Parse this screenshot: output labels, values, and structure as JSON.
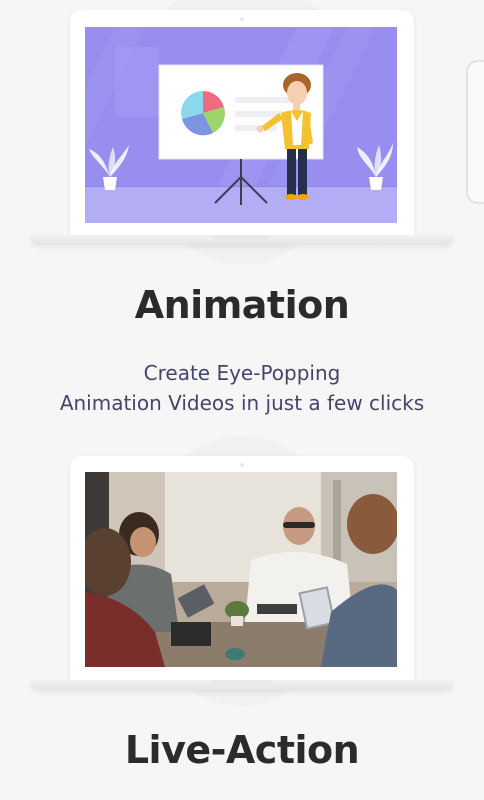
{
  "sections": [
    {
      "title": "Animation",
      "subtitle_line1": "Create Eye-Popping",
      "subtitle_line2": "Animation Videos in just a few clicks",
      "illustration": "animation-presenter-illustration"
    },
    {
      "title": "Live-Action",
      "illustration": "live-action-meeting-photo"
    }
  ],
  "colors": {
    "background": "#f6f6f7",
    "animation_screen": "#8f86ee",
    "heading": "#2b2b2e",
    "subtitle": "#45456a"
  }
}
